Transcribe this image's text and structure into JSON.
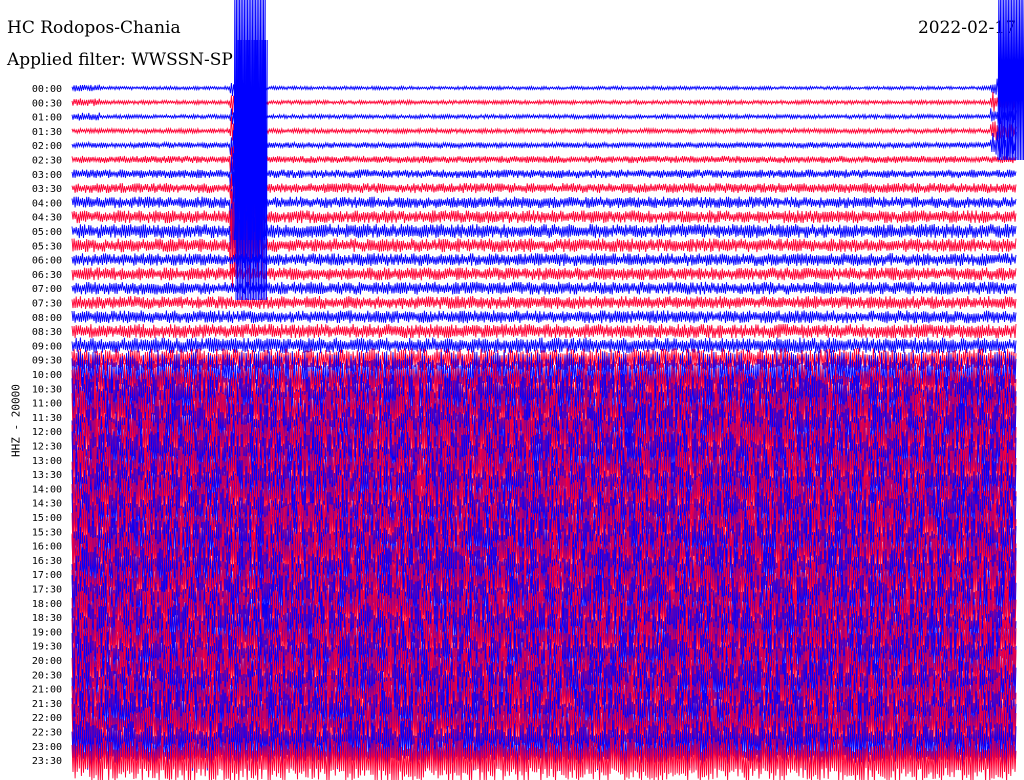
{
  "header": {
    "station": "HC Rodopos-Chania",
    "filter": "Applied filter: WWSSN-SP",
    "date": "2022-02-17"
  },
  "channel_label": "HHZ - 20000",
  "colors": {
    "trace_a": "#0000ff",
    "trace_b": "#ff0033",
    "background": "#ffffff"
  },
  "chart_data": {
    "type": "line",
    "title": "HC Rodopos-Chania",
    "subtitle": "Applied filter: WWSSN-SP",
    "ylabel": "HHZ - 20000",
    "rows": [
      "00:00",
      "00:30",
      "01:00",
      "01:30",
      "02:00",
      "02:30",
      "03:00",
      "03:30",
      "04:00",
      "04:30",
      "05:00",
      "05:30",
      "06:00",
      "06:30",
      "07:00",
      "07:30",
      "08:00",
      "08:30",
      "09:00",
      "09:30",
      "10:00",
      "10:30",
      "11:00",
      "11:30",
      "12:00",
      "12:30",
      "13:00",
      "13:30",
      "14:00",
      "14:30",
      "15:00",
      "15:30",
      "16:00",
      "16:30",
      "17:00",
      "17:30",
      "18:00",
      "18:30",
      "19:00",
      "19:30",
      "20:00",
      "20:30",
      "21:00",
      "21:30",
      "22:00",
      "22:30",
      "23:00",
      "23:30"
    ],
    "row_colors": [
      "blue",
      "red"
    ],
    "amplitude_by_row": [
      0.12,
      0.14,
      0.14,
      0.16,
      0.2,
      0.25,
      0.3,
      0.35,
      0.4,
      0.45,
      0.5,
      0.48,
      0.45,
      0.45,
      0.45,
      0.45,
      0.45,
      0.5,
      0.55,
      0.8,
      1.6,
      1.8,
      2.0,
      2.0,
      2.0,
      2.0,
      2.0,
      2.0,
      2.0,
      2.0,
      2.0,
      2.0,
      2.0,
      2.0,
      2.0,
      2.0,
      2.0,
      2.0,
      2.0,
      2.0,
      2.0,
      2.0,
      2.0,
      2.0,
      2.0,
      2.0,
      1.8,
      1.6
    ]
  }
}
